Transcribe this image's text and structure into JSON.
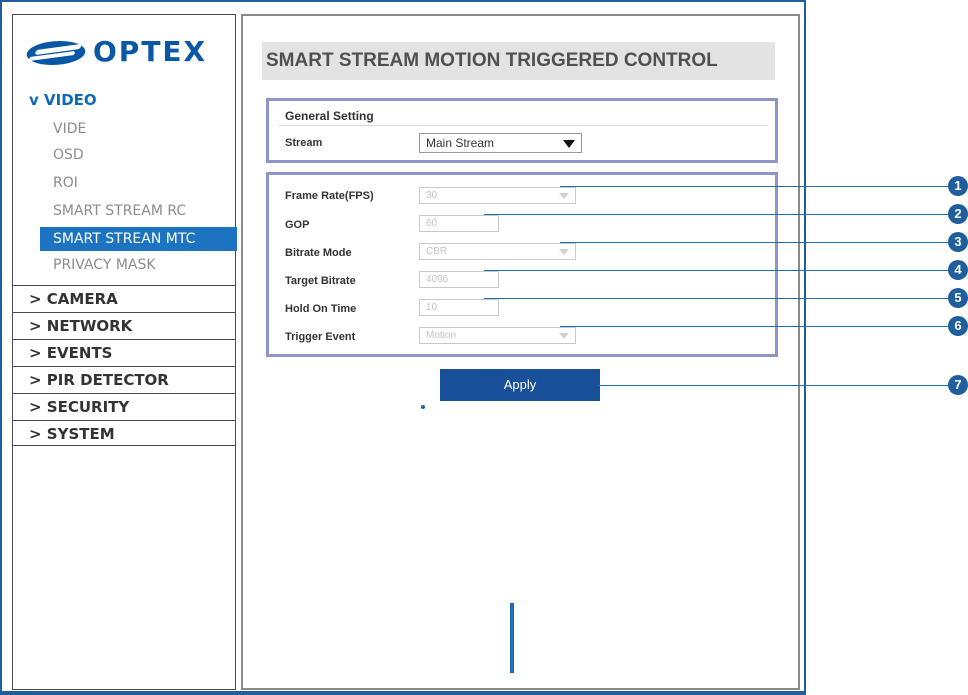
{
  "logo_text": "OPTEX",
  "sidebar": {
    "video_header": "v VIDEO",
    "video_items": [
      "VIDE",
      "OSD",
      "ROI",
      "SMART STREAM RC",
      "SMART STREAN MTC",
      "PRIVACY MASK"
    ],
    "active_item": "SMART STREAN MTC",
    "sections": [
      "> CAMERA",
      "> NETWORK",
      "> EVENTS",
      "> PIR DETECTOR",
      "> SECURITY",
      "> SYSTEM"
    ]
  },
  "page_title": "SMART STREAM MOTION TRIGGERED CONTROL",
  "general": {
    "title": "General Setting",
    "stream_label": "Stream",
    "stream_value": "Main Stream"
  },
  "settings": {
    "frame_rate": {
      "label": "Frame Rate(FPS)",
      "value": "30"
    },
    "gop": {
      "label": "GOP",
      "value": "60"
    },
    "bitrate_mode": {
      "label": "Bitrate Mode",
      "value": "CBR"
    },
    "target_bitrate": {
      "label": "Target Bitrate",
      "value": "4096"
    },
    "hold_on_time": {
      "label": "Hold On Time",
      "value": "10"
    },
    "trigger_event": {
      "label": "Trigger Event",
      "value": "Motion"
    }
  },
  "apply_label": "Apply",
  "callouts": [
    "1",
    "2",
    "3",
    "4",
    "5",
    "6",
    "7"
  ],
  "colors": {
    "accent": "#1f5f9e",
    "active_menu": "#1b73c2",
    "apply": "#174f99",
    "box_border": "#8f95c6"
  }
}
